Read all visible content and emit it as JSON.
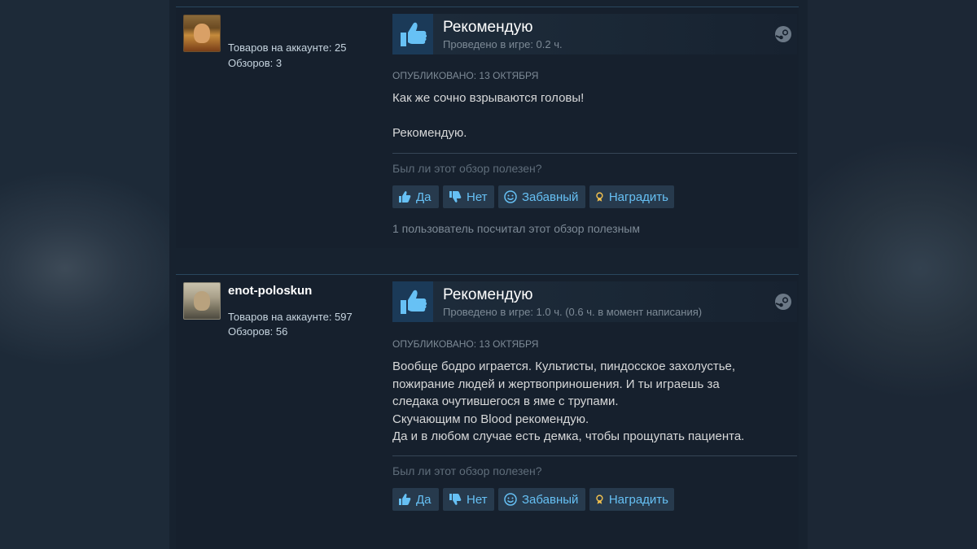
{
  "reviews": [
    {
      "author": {
        "name": "",
        "products_label": "Товаров на аккаунте: 25",
        "reviews_label": "Обзоров: 3"
      },
      "verdict": "Рекомендую",
      "hours": "Проведено в игре: 0.2 ч.",
      "posted": "Опубликовано: 13 октября",
      "text": [
        "Как же сочно взрываются головы!",
        "",
        "Рекомендую."
      ],
      "helpful_question": "Был ли этот обзор полезен?",
      "buttons": {
        "yes": "Да",
        "no": "Нет",
        "funny": "Забавный",
        "award": "Наградить"
      },
      "helpful_count": "1 пользователь посчитал этот обзор полезным"
    },
    {
      "author": {
        "name": "enot-poloskun",
        "products_label": "Товаров на аккаунте: 597",
        "reviews_label": "Обзоров: 56"
      },
      "verdict": "Рекомендую",
      "hours": "Проведено в игре: 1.0 ч. (0.6 ч. в момент написания)",
      "posted": "Опубликовано: 13 октября",
      "text": [
        "Вообще бодро играется. Культисты, пиндосское захолустье,",
        "пожирание людей и жертвоприношения. И ты играешь за",
        "следака очутившегося в яме с трупами.",
        "Скучающим по Blood рекомендую.",
        "Да и в любом случае есть демка, чтобы прощупать пациента."
      ],
      "helpful_question": "Был ли этот обзор полезен?",
      "buttons": {
        "yes": "Да",
        "no": "Нет",
        "funny": "Забавный",
        "award": "Наградить"
      }
    }
  ],
  "icons": {
    "thumb": "thumbs-up-icon",
    "steam": "steam-icon",
    "yes": "thumbs-up-icon",
    "no": "thumbs-down-icon",
    "funny": "smiley-icon",
    "award": "award-icon"
  },
  "colors": {
    "background": "#1b2838",
    "panel": "#16202d",
    "link": "#66c0f4",
    "thumb": "#67c1f5",
    "award": "#f2c14e"
  }
}
